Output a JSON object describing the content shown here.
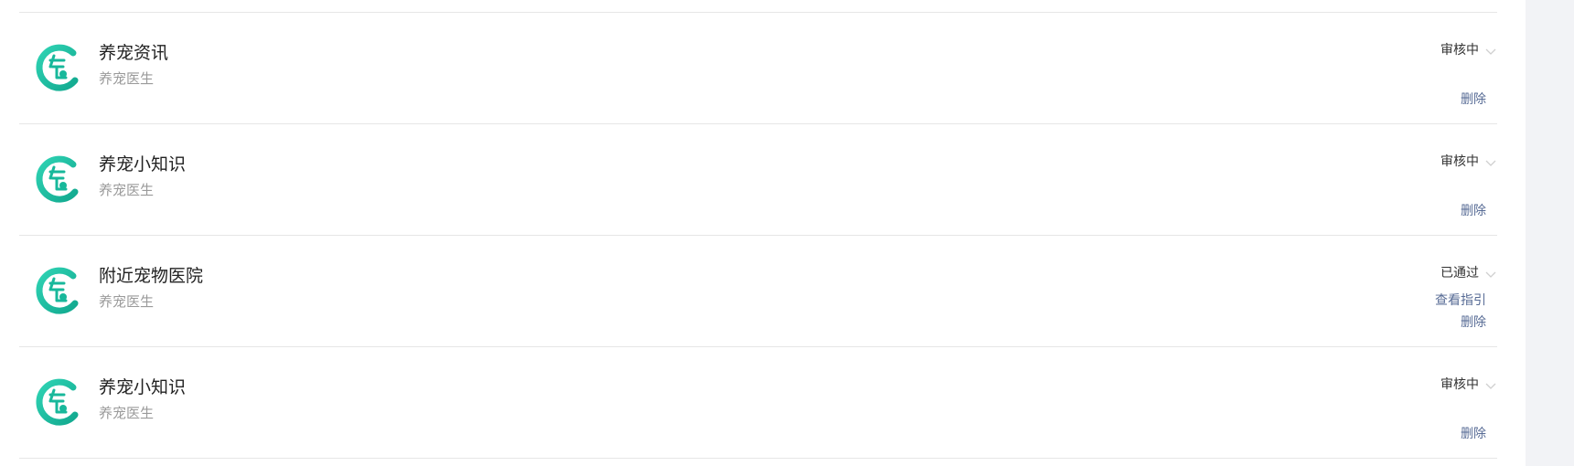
{
  "list": {
    "items": [
      {
        "title": "养宠资讯",
        "subtitle": "养宠医生",
        "status": "审核中",
        "actions": [
          "删除"
        ]
      },
      {
        "title": "养宠小知识",
        "subtitle": "养宠医生",
        "status": "审核中",
        "actions": [
          "删除"
        ]
      },
      {
        "title": "附近宠物医院",
        "subtitle": "养宠医生",
        "status": "已通过",
        "actions": [
          "查看指引",
          "删除"
        ]
      },
      {
        "title": "养宠小知识",
        "subtitle": "养宠医生",
        "status": "审核中",
        "actions": [
          "删除"
        ]
      }
    ]
  },
  "colors": {
    "accent": "#20c4a8",
    "link": "#576b95",
    "divider": "#e6e6e6",
    "gutter": "#f2f3f6"
  },
  "icons": {
    "avatar": "pet-doctor-logo-icon",
    "status_toggle": "chevron-down-icon"
  }
}
